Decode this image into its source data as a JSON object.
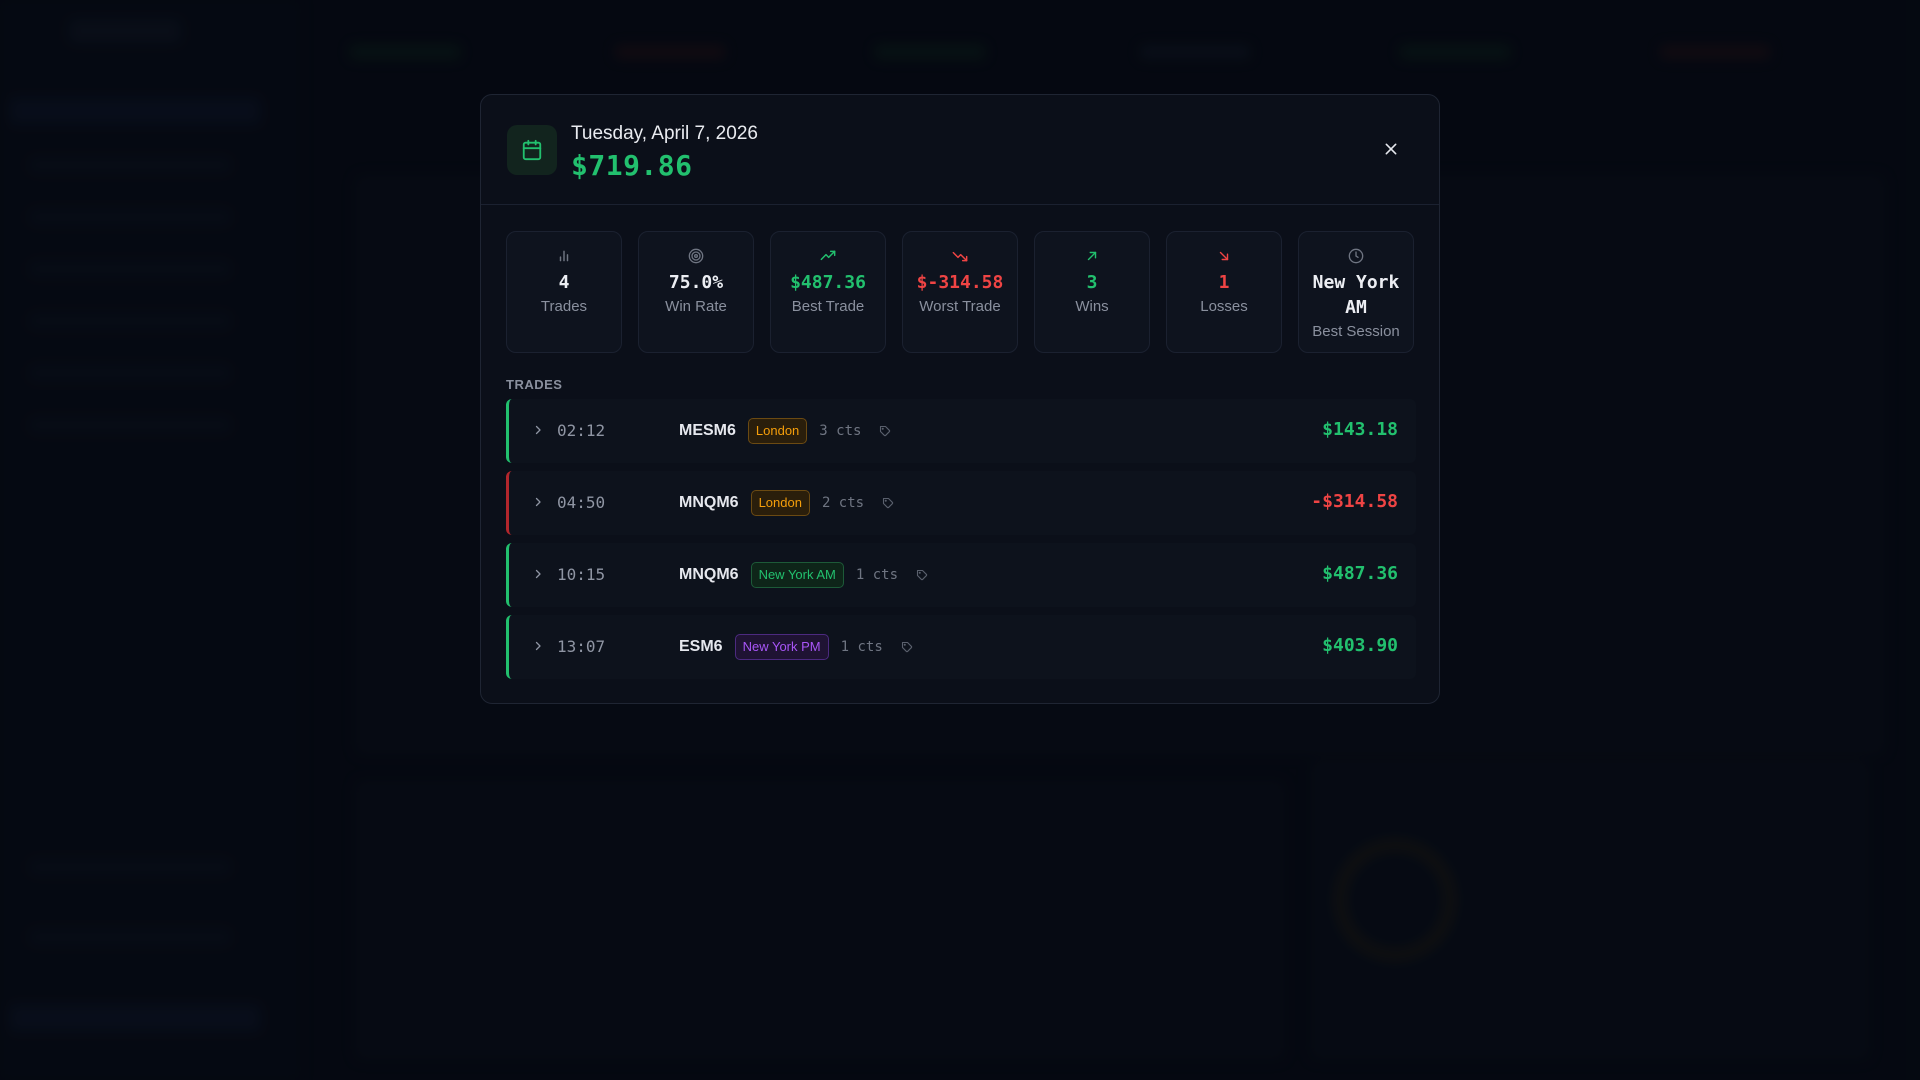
{
  "modal": {
    "date": "Tuesday, April 7, 2026",
    "pnl": "$719.86"
  },
  "stats": [
    {
      "icon": "bar-chart-icon",
      "value": "4",
      "label": "Trades",
      "tone": "white"
    },
    {
      "icon": "target-icon",
      "value": "75.0%",
      "label": "Win Rate",
      "tone": "white"
    },
    {
      "icon": "trending-up-icon",
      "value": "$487.36",
      "label": "Best Trade",
      "tone": "green"
    },
    {
      "icon": "trending-down-icon",
      "value": "$-314.58",
      "label": "Worst Trade",
      "tone": "red"
    },
    {
      "icon": "arrow-up-right-icon",
      "value": "3",
      "label": "Wins",
      "tone": "green"
    },
    {
      "icon": "arrow-down-right-icon",
      "value": "1",
      "label": "Losses",
      "tone": "red"
    },
    {
      "icon": "clock-icon",
      "value": "New York AM",
      "label": "Best Session",
      "tone": "white"
    }
  ],
  "trades_label": "TRADES",
  "trades": [
    {
      "time": "02:12",
      "symbol": "MESM6",
      "session": "London",
      "contracts": "3 cts",
      "pnl": "$143.18",
      "result": "win"
    },
    {
      "time": "04:50",
      "symbol": "MNQM6",
      "session": "London",
      "contracts": "2 cts",
      "pnl": "-$314.58",
      "result": "loss"
    },
    {
      "time": "10:15",
      "symbol": "MNQM6",
      "session": "New York AM",
      "contracts": "1 cts",
      "pnl": "$487.36",
      "result": "win"
    },
    {
      "time": "13:07",
      "symbol": "ESM6",
      "session": "New York PM",
      "contracts": "1 cts",
      "pnl": "$403.90",
      "result": "win"
    }
  ],
  "colors": {
    "profit": "#22c06e",
    "loss": "#ef4444",
    "london": "#f59e0b",
    "new_york_am": "#22c06e",
    "new_york_pm": "#a855f7"
  }
}
